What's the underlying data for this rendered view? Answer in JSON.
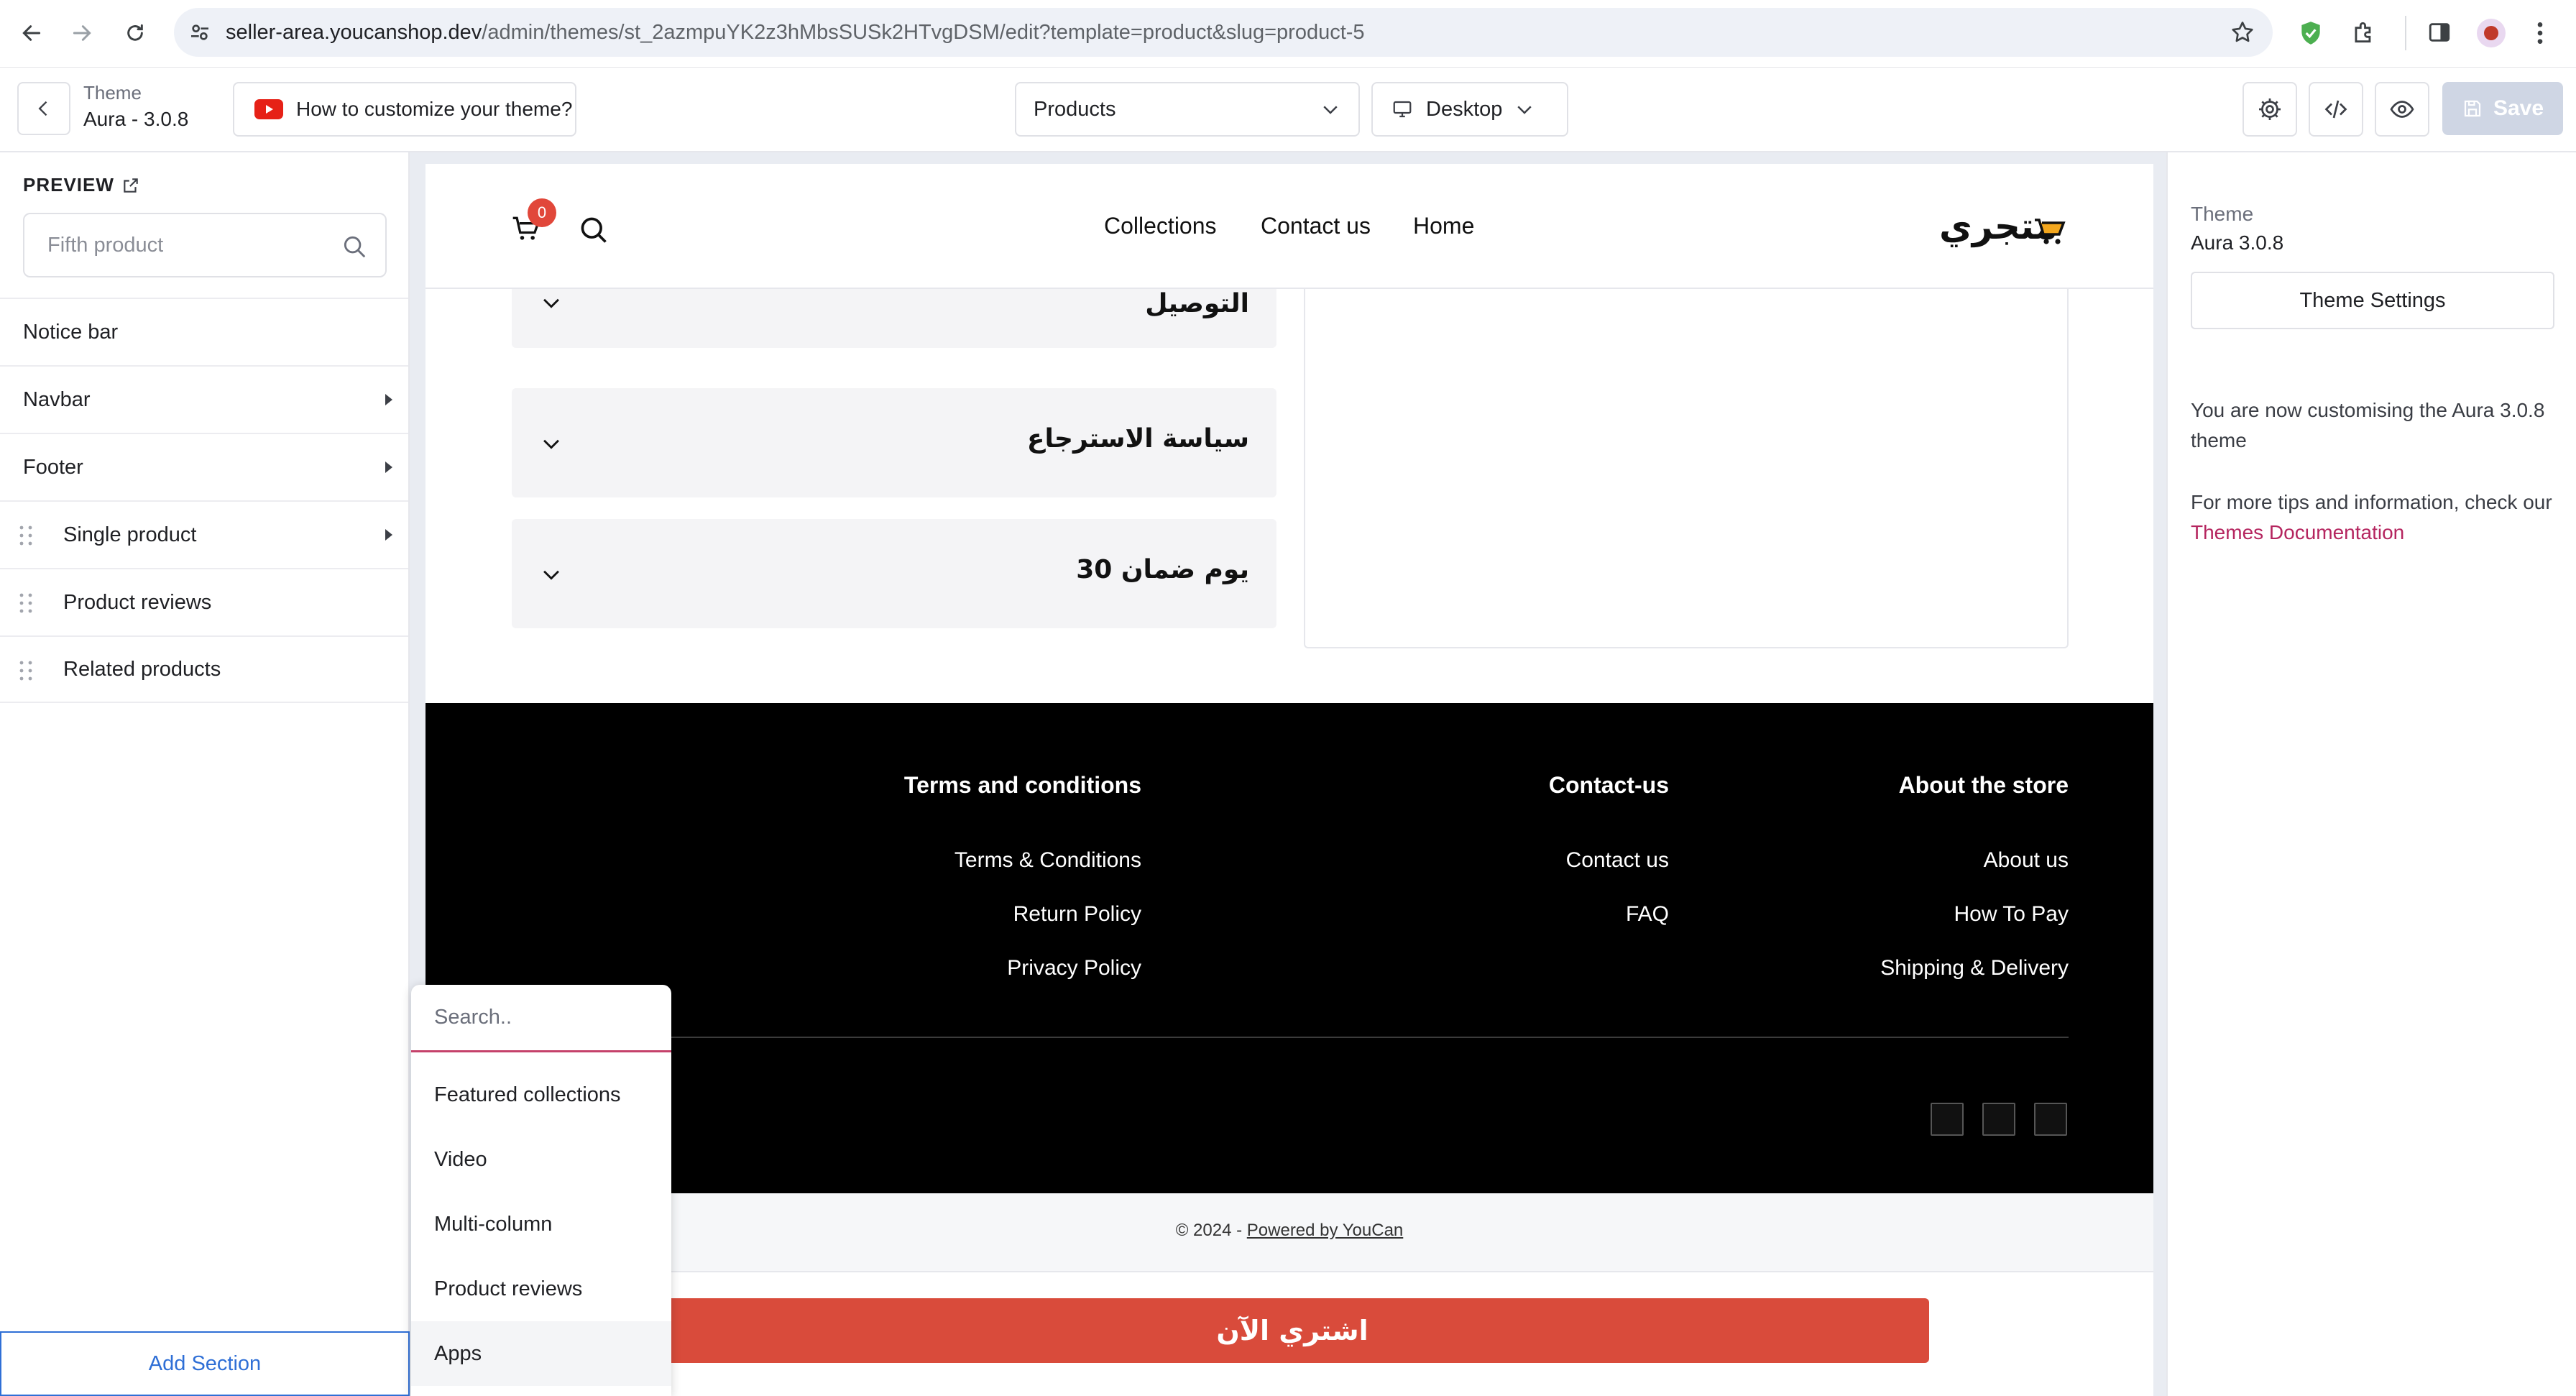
{
  "browser": {
    "url_host": "seller-area.youcanshop.dev",
    "url_path": "/admin/themes/st_2azmpuYK2z3hMbsSUSk2HTvgDSM/edit?template=product&slug=product-5"
  },
  "toolbar": {
    "theme_label": "Theme",
    "theme_version": "Aura - 3.0.8",
    "howto_label": "How to customize your theme?",
    "page_select": "Products",
    "device_select": "Desktop",
    "save_label": "Save"
  },
  "sidebar": {
    "preview_label": "PREVIEW",
    "search_placeholder": "Fifth product",
    "items": [
      {
        "label": "Notice bar"
      },
      {
        "label": "Navbar"
      },
      {
        "label": "Footer"
      },
      {
        "label": "Single product"
      },
      {
        "label": "Product reviews"
      },
      {
        "label": "Related products"
      }
    ],
    "add_section": "Add Section"
  },
  "store": {
    "cart_count": "0",
    "nav": [
      "Collections",
      "Contact us",
      "Home"
    ],
    "logo": "متجري",
    "accordions": [
      "التوصيل",
      "سياسة الاسترجاع",
      "30 يوم ضمان"
    ],
    "footer": {
      "col1": {
        "title": "Terms and conditions",
        "links": [
          "Terms & Conditions",
          "Return Policy",
          "Privacy Policy"
        ]
      },
      "col2": {
        "title": "Contact-us",
        "links": [
          "Contact us",
          "FAQ"
        ]
      },
      "col3": {
        "title": "About the store",
        "links": [
          "About us",
          "How To Pay",
          "Shipping & Delivery"
        ]
      }
    },
    "copyright_prefix": "© 2024 - ",
    "copyright_link": "Powered by YouCan",
    "buy_button": "اشتري الآن"
  },
  "popup": {
    "search_placeholder": "Search..",
    "items": [
      "Featured collections",
      "Video",
      "Multi-column",
      "Product reviews",
      "Apps"
    ]
  },
  "right_panel": {
    "theme_label": "Theme",
    "theme_version": "Aura 3.0.8",
    "settings_button": "Theme Settings",
    "text1": "You are now customising the Aura 3.0.8 theme",
    "text2_prefix": "For more tips and information, check our ",
    "doc_link": "Themes Documentation"
  },
  "colors": {
    "accent_blue": "#2f6fd6",
    "buy_red": "#d94b3b",
    "link_magenta": "#b5255f"
  }
}
